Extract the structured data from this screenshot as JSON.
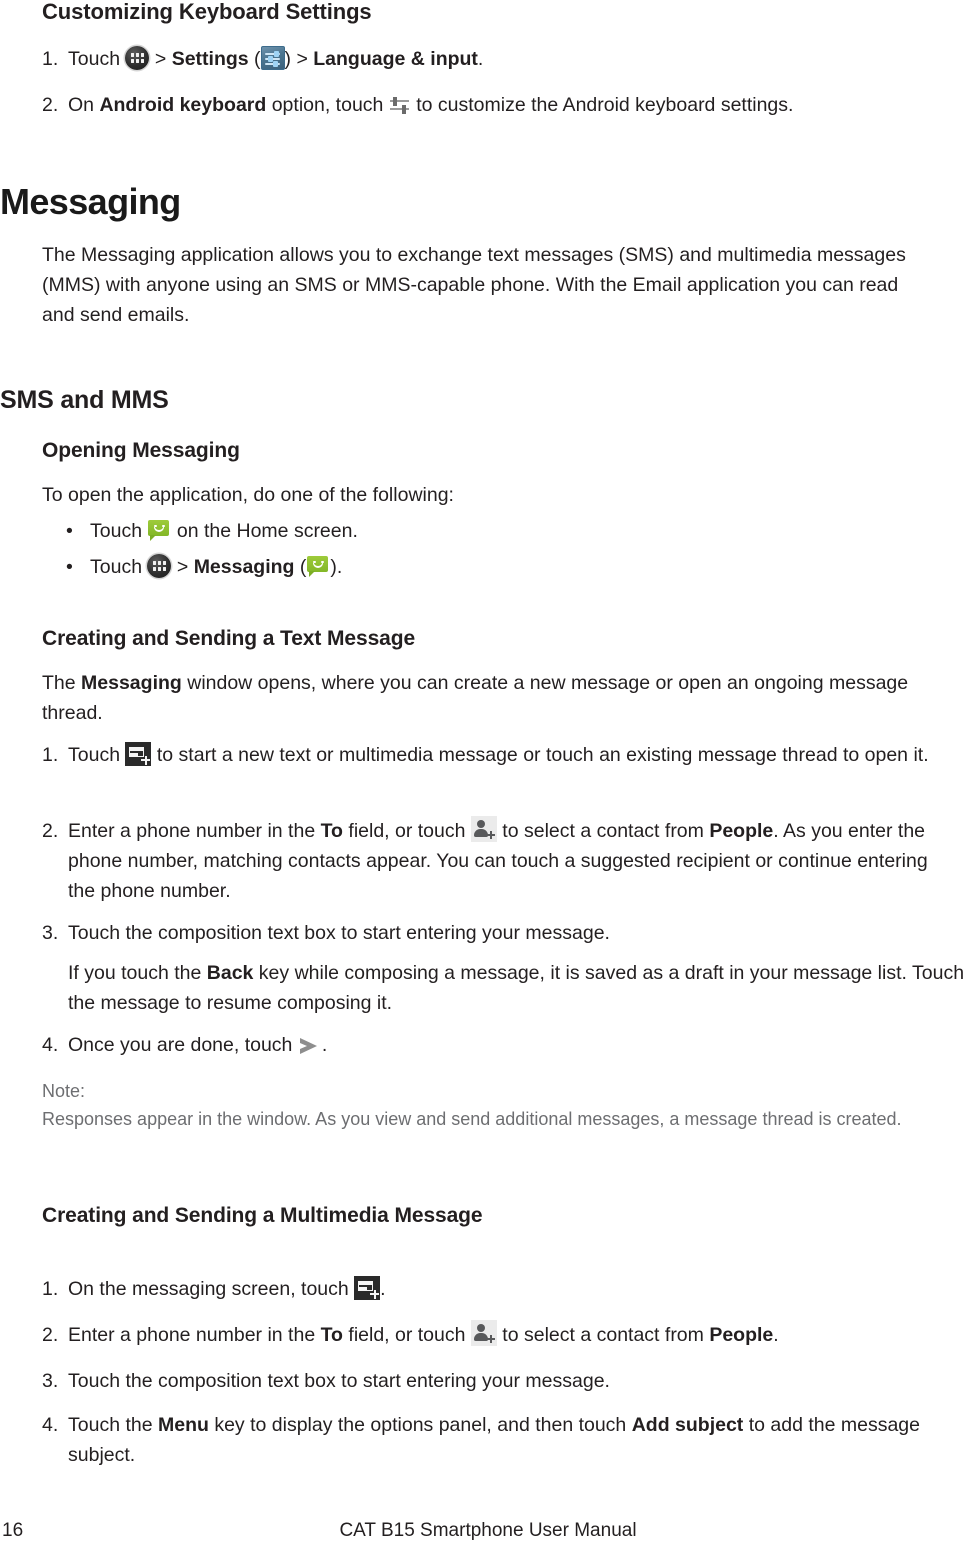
{
  "document": {
    "section_heading": "Customizing Keyboard Settings",
    "keyboard_steps": [
      {
        "num": "1.",
        "parts": [
          {
            "t": "text",
            "v": "Touch "
          },
          {
            "t": "icon",
            "v": "app-drawer-icon"
          },
          {
            "t": "text",
            "v": " > "
          },
          {
            "t": "bold",
            "v": "Settings"
          },
          {
            "t": "text",
            "v": " ("
          },
          {
            "t": "icon",
            "v": "settings-icon"
          },
          {
            "t": "text",
            "v": ") > "
          },
          {
            "t": "bold",
            "v": "Language & input"
          },
          {
            "t": "text",
            "v": "."
          }
        ],
        "plain": "Touch  > Settings ( ) > Language & input."
      },
      {
        "num": "2.",
        "parts": [
          {
            "t": "text",
            "v": "On "
          },
          {
            "t": "bold",
            "v": "Android keyboard"
          },
          {
            "t": "text",
            "v": " option, touch "
          },
          {
            "t": "icon",
            "v": "sliders-icon"
          },
          {
            "t": "text",
            "v": " to customize the Android keyboard settings."
          }
        ],
        "plain": "On Android keyboard option, touch  to customize the Android keyboard settings."
      }
    ],
    "messaging": {
      "title": "Messaging",
      "intro": "The Messaging application allows you to exchange text messages (SMS) and multimedia messages (MMS) with anyone using an SMS or MMS-capable phone. With the Email application you can read and send emails."
    },
    "sms_mms": {
      "title": "SMS and MMS",
      "opening": {
        "title": "Opening Messaging",
        "lead": "To open the application, do one of the following:",
        "bullets": [
          {
            "prefix": "Touch ",
            "icon": "messaging-icon",
            "suffix": " on the Home screen.",
            "plain": "Touch  on the Home screen."
          },
          {
            "prefix": "Touch ",
            "icon": "app-drawer-icon",
            "mid_text": " > ",
            "bold": "Messaging",
            "paren_open": " (",
            "icon2": "messaging-icon",
            "paren_close": ").",
            "plain": "Touch  > Messaging ( )."
          }
        ]
      },
      "text_message": {
        "title": "Creating and Sending a Text Message",
        "lead_parts": [
          {
            "t": "text",
            "v": "The "
          },
          {
            "t": "bold",
            "v": "Messaging"
          },
          {
            "t": "text",
            "v": " window opens, where you can create a new message or open an ongoing message thread."
          }
        ],
        "lead_plain": "The Messaging window opens, where you can create a new message or open an ongoing message thread.",
        "steps": [
          {
            "num": "1.",
            "plain": "Touch  to start a new text or multimedia message or touch an existing message thread to open it."
          },
          {
            "num": "2.",
            "plain": "Enter a phone number in the To field, or touch  to select a contact from People. As you enter the phone number, matching contacts appear. You can touch a suggested recipient or continue entering the phone number."
          },
          {
            "num": "3.",
            "plain": "Touch the composition text box to start entering your message.",
            "sub": "If you touch the Back key while composing a message, it is saved as a draft in your message list. Touch the message to resume composing it."
          },
          {
            "num": "4.",
            "plain": "Once you are done, touch  ."
          }
        ],
        "note_label": "Note:",
        "note_text": "Responses appear in the window. As you view and send additional messages, a message thread is created."
      },
      "multimedia_message": {
        "title": "Creating and Sending a Multimedia Message",
        "steps": [
          {
            "num": "1.",
            "plain": "On the messaging screen, touch  ."
          },
          {
            "num": "2.",
            "plain": "Enter a phone number in the To field, or touch  to select a contact from People."
          },
          {
            "num": "3.",
            "plain": "Touch the composition text box to start entering your message."
          },
          {
            "num": "4.",
            "plain": "Touch the Menu key to display the options panel, and then touch Add subject to add the message subject."
          }
        ]
      }
    },
    "inline_bold": {
      "settings": "Settings",
      "language_input": "Language & input",
      "android_keyboard": "Android keyboard",
      "messaging": "Messaging",
      "to": "To",
      "people": "People",
      "back": "Back",
      "menu": "Menu",
      "add_subject": "Add subject"
    },
    "fragments": {
      "touch": "Touch ",
      "gt": " > ",
      "paren_open": " (",
      "paren_close": ").",
      "paren_close_gt": ") > ",
      "period": ".",
      "s1_on": "On ",
      "s1_option_touch": " option, touch ",
      "s1_customize": " to customize the Android keyboard settings.",
      "b1_home": " on the Home screen.",
      "lead_the": "The ",
      "lead_window": " window opens, where you can create a new message or open an ongoing message thread.",
      "t1_start": " to start a new text or multimedia message or touch an existing message thread to open it.",
      "t2_enter": "Enter a phone number in the ",
      "t2_field": " field, or touch ",
      "t2_select": " to select a contact from ",
      "t2_asyou": ". As you enter the phone number, matching contacts appear. You can touch a suggested recipient or continue entering the phone number.",
      "t3_compose": "Touch the composition text box to start entering your message.",
      "t3_sub_a": "If you touch the ",
      "t3_sub_b": " key while composing a message, it is saved as a draft in your message list. Touch the message to resume composing it.",
      "t4_done": "Once you are done, touch ",
      "m1_screen": "On the messaging screen, touch ",
      "m2_select_end": " to select a contact from ",
      "m2_end": ".",
      "m4_a": "Touch the ",
      "m4_b": " key to display the options panel, and then touch ",
      "m4_c": " to add the message subject."
    },
    "footer": {
      "page_number": "16",
      "manual_title": "CAT B15 Smartphone User Manual"
    },
    "colors": {
      "text": "#231f20",
      "note_text": "#6d6e71",
      "messaging_green": "#8cc63f",
      "settings_blue": "#4c7691",
      "icon_gray": "#8e8e8e"
    }
  }
}
